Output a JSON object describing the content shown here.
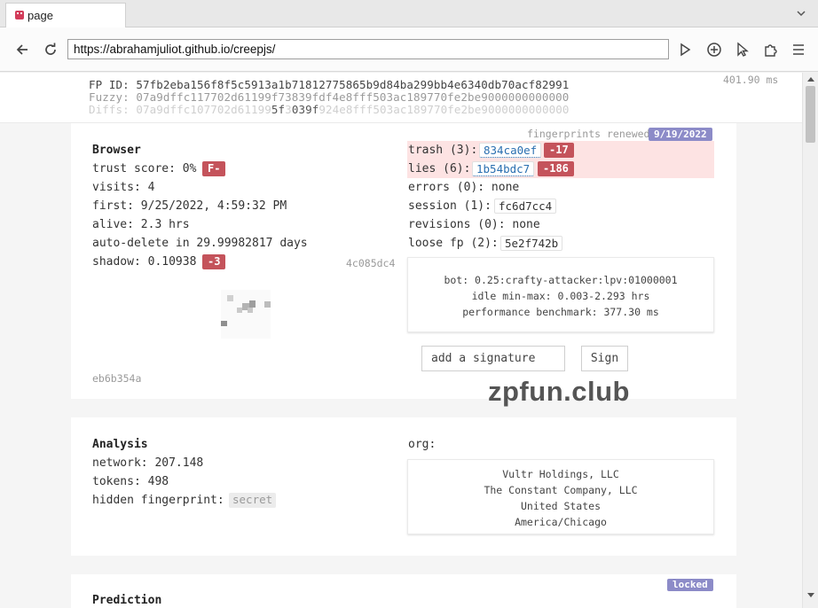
{
  "tab": {
    "title": "page"
  },
  "toolbar": {
    "url": "https://abrahamjuliot.github.io/creepjs/"
  },
  "header": {
    "fp_id": "FP ID: 57fb2eba156f8f5c5913a1b71812775865b9d84ba299bb4e6340db70acf82991",
    "fuzzy": "Fuzzy: 07a9dffc117702d61199f73839fdf4e8fff503ac189770fe2be9000000000000",
    "diffs": "Diffs: 07a9dffc107702d61199",
    "diffs_mid1": "5f",
    "diffs_mid2": "3",
    "diffs_mid3": "039f",
    "diffs_mid4": "92",
    "diffs_tail": "4e8fff503ac189770fe2be9000000000000",
    "timing": "401.90 ms"
  },
  "browser": {
    "renewed_label": "fingerprints renewed",
    "renewed_date": "9/19/2022",
    "title": "Browser",
    "trust_score": "trust score: 0%",
    "trust_grade": "F-",
    "visits": "visits: 4",
    "first": "first: 9/25/2022, 4:59:32 PM",
    "alive": "alive: 2.3 hrs",
    "auto_delete": "auto-delete in 29.99982817 days",
    "shadow": "shadow: 0.10938",
    "shadow_badge": "-3",
    "shadow_hash": "4c085dc4",
    "footer_hash": "eb6b354a",
    "trash_label": "trash (3):",
    "trash_hash": "834ca0ef",
    "trash_badge": "-17",
    "lies_label": "lies (6):",
    "lies_hash": "1b54bdc7",
    "lies_badge": "-186",
    "errors": "errors (0): none",
    "session_label": "session (1):",
    "session_hash": "fc6d7cc4",
    "revisions": "revisions (0): none",
    "loose_label": "loose fp (2):",
    "loose_hash": "5e2f742b",
    "bot_line": "bot: 0.25:crafty-attacker:lpv:01000001",
    "idle_line": "idle min-max: 0.003-2.293 hrs",
    "perf_line": "performance benchmark: 377.30 ms",
    "signature_placeholder": "add a signature",
    "sign_label": "Sign"
  },
  "watermark": "zpfun.club",
  "analysis": {
    "title": "Analysis",
    "network": "network: 207.148",
    "tokens": "tokens: 498",
    "hidden_label": "hidden fingerprint:",
    "hidden_value": "secret",
    "org_label": "org:",
    "org_lines": [
      "Vultr Holdings, LLC",
      "The Constant Company, LLC",
      "United States",
      "America/Chicago"
    ]
  },
  "prediction": {
    "title": "Prediction",
    "locked": "locked"
  },
  "colors": {
    "red_badge": "#c4535b",
    "purple_badge": "#8c8bc8",
    "highlight": "#fde3e3",
    "link": "#2a6fb0"
  }
}
